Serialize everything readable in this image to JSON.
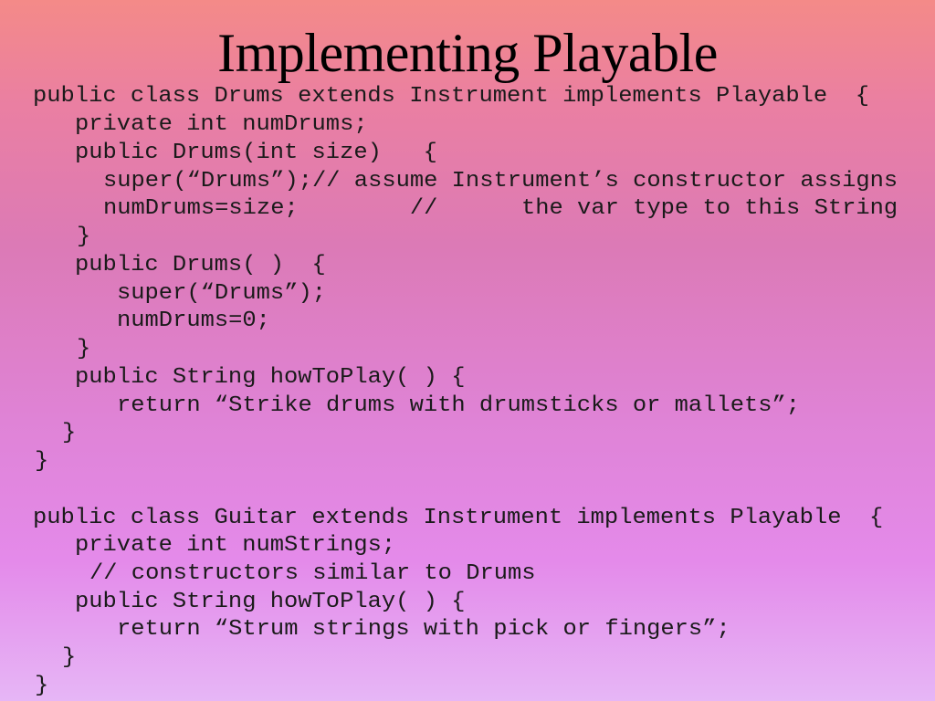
{
  "slide": {
    "title": "Implementing Playable",
    "code_lines": [
      "public class Drums extends Instrument implements Playable  {",
      "private int numDrums;",
      "public Drums(int size)   {",
      "super(“Drums”);// assume Instrument’s constructor assigns",
      "numDrums=size;        //      the var type to this String",
      "}",
      "public Drums( )  {",
      "super(“Drums”);",
      "numDrums=0;",
      "}",
      "public String howToPlay( ) {",
      "return “Strike drums with drumsticks or mallets”;",
      "}",
      "}",
      "public class Guitar extends Instrument implements Playable  {",
      "private int numStrings;",
      "// constructors similar to Drums",
      "public String howToPlay( ) {",
      "return “Strum strings with pick or fingers”;",
      "}",
      "}"
    ]
  }
}
